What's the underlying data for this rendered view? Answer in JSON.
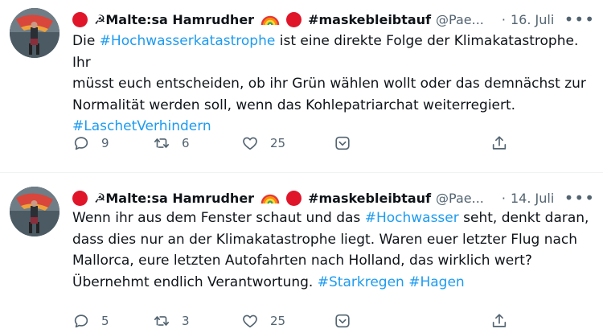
{
  "tweets": [
    {
      "author": "☭Malte:sa Hamrudher",
      "hashtag_name": "#maskebleibtauf",
      "handle": "@Pae...",
      "separator": "·",
      "date": "16. Juli",
      "more_label": "•••",
      "body": [
        {
          "text": "Die ",
          "tag": false
        },
        {
          "text": "#Hochwasserkatastrophe",
          "tag": true
        },
        {
          "text": " ist eine direkte Folge der Klimakatastrophe. Ihr\nmüsst euch entscheiden, ob ihr Grün wählen wollt oder das demnächst zur\nNormalität werden soll, wenn das Kohlepatriarchat weiterregiert.\n",
          "tag": false
        },
        {
          "text": "#LaschetVerhindern",
          "tag": true
        }
      ],
      "replies": "9",
      "retweets": "6",
      "likes": "25"
    },
    {
      "author": "☭Malte:sa Hamrudher",
      "hashtag_name": "#maskebleibtauf",
      "handle": "@Pae...",
      "separator": "·",
      "date": "14. Juli",
      "more_label": "•••",
      "body": [
        {
          "text": "Wenn ihr aus dem Fenster schaut und das ",
          "tag": false
        },
        {
          "text": "#Hochwasser",
          "tag": true
        },
        {
          "text": " seht, denkt daran,\ndass dies nur an der Klimakatastrophe liegt. Waren euer letzter Flug nach\nMallorca, eure letzten Autofahrten nach Holland, das wirklich wert?\nÜbernehmt endlich Verantwortung. ",
          "tag": false
        },
        {
          "text": "#Starkregen",
          "tag": true
        },
        {
          "text": " ",
          "tag": false
        },
        {
          "text": "#Hagen",
          "tag": true
        }
      ],
      "replies": "5",
      "retweets": "3",
      "likes": "25"
    }
  ],
  "colors": {
    "accent": "#1d9bf0",
    "red_dot": "#e0152a",
    "muted": "#536471",
    "text": "#0f1419"
  },
  "icons": [
    "reply-icon",
    "retweet-icon",
    "like-icon",
    "react-icon",
    "share-icon",
    "rainbow-icon",
    "hammer-sickle-icon"
  ]
}
